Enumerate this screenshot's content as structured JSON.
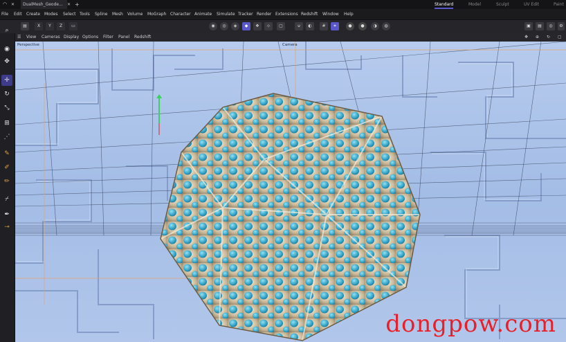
{
  "titlebar": {
    "tabs": [
      {
        "label": "DualMesh_Geode..."
      },
      {
        "label": "+"
      }
    ],
    "layouts": [
      "Standard",
      "Model",
      "Sculpt",
      "UV Edit",
      "Paint"
    ],
    "active_layout": "Standard"
  },
  "menu": [
    "File",
    "Edit",
    "Create",
    "Modes",
    "Select",
    "Tools",
    "Spline",
    "Mesh",
    "Volume",
    "MoGraph",
    "Character",
    "Animate",
    "Simulate",
    "Tracker",
    "Render",
    "Extensions",
    "Redshift",
    "Window",
    "Help"
  ],
  "toolbar": {
    "axes": [
      "X",
      "Y",
      "Z"
    ],
    "lock_icon": "lock-icon"
  },
  "viewport_menu": [
    "View",
    "Cameras",
    "Display",
    "Options",
    "Filter",
    "Panel",
    "Redshift"
  ],
  "viewport": {
    "label": "Perspective",
    "camera_label": "Camera"
  },
  "watermark": "dongpow.com",
  "colors": {
    "accent": "#5a58c8",
    "viewport_bg": "#a9c0e6",
    "mesh_metal": "#cfc2a8",
    "mesh_inner": "#3fa8c8"
  }
}
